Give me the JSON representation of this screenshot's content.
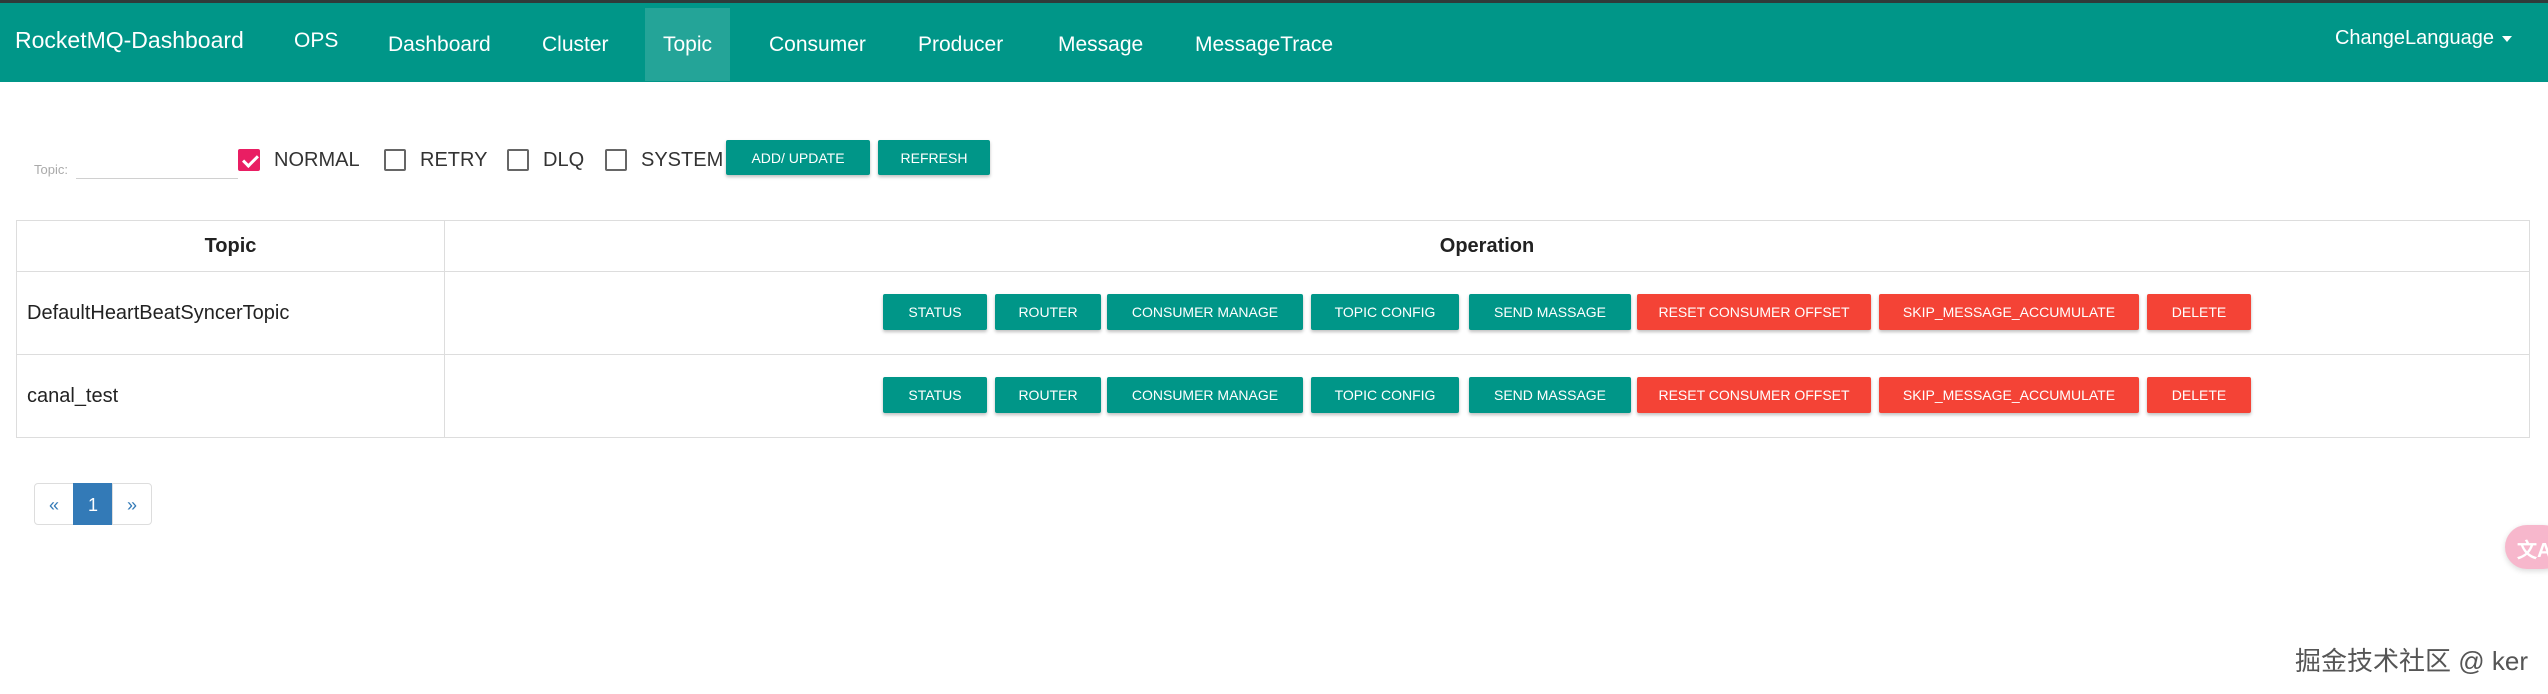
{
  "navbar": {
    "brand": "RocketMQ-Dashboard",
    "items": [
      "OPS",
      "Dashboard",
      "Cluster",
      "Topic",
      "Consumer",
      "Producer",
      "Message",
      "MessageTrace"
    ],
    "active": "Topic",
    "language": "ChangeLanguage"
  },
  "filter": {
    "topic_label": "Topic:",
    "topic_value": "",
    "checkboxes": [
      {
        "label": "NORMAL",
        "checked": true
      },
      {
        "label": "RETRY",
        "checked": false
      },
      {
        "label": "DLQ",
        "checked": false
      },
      {
        "label": "SYSTEM",
        "checked": false
      }
    ],
    "add_update_label": "ADD/ UPDATE",
    "refresh_label": "REFRESH"
  },
  "table": {
    "headers": [
      "Topic",
      "Operation"
    ],
    "operations": [
      "STATUS",
      "ROUTER",
      "CONSUMER MANAGE",
      "TOPIC CONFIG",
      "SEND MASSAGE",
      "RESET CONSUMER OFFSET",
      "SKIP_MESSAGE_ACCUMULATE",
      "DELETE"
    ],
    "rows": [
      {
        "topic": "DefaultHeartBeatSyncerTopic"
      },
      {
        "topic": "canal_test"
      }
    ]
  },
  "pagination": {
    "prev": "«",
    "current": "1",
    "next": "»"
  },
  "translate_icon": "文A",
  "watermark": "掘金技术社区 @ ker",
  "colors": {
    "primary": "#009688",
    "danger": "#f44336",
    "checkbox": "#e91e63",
    "page_active": "#337ab7"
  }
}
